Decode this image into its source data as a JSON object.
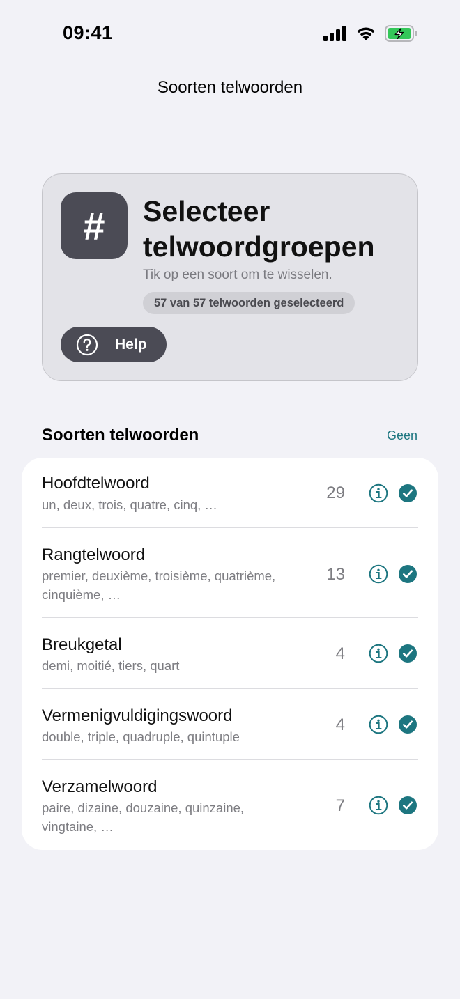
{
  "status_bar": {
    "time": "09:41",
    "icons": [
      "cellular-signal-icon",
      "wifi-icon",
      "battery-charging-icon"
    ],
    "battery_color": "#34c759"
  },
  "nav": {
    "title": "Soorten telwoorden"
  },
  "header": {
    "icon": "hash-icon",
    "icon_glyph": "#",
    "title": "Selecteer telwoordgroepen",
    "subtitle": "Tik op een soort om te wisselen.",
    "count_badge": "57 van 57 telwoorden geselecteerd",
    "help_label": "Help"
  },
  "section": {
    "title": "Soorten telwoorden",
    "action_label": "Geen"
  },
  "colors": {
    "accent": "#1d7680",
    "dark_tile": "#4b4b55",
    "background": "#f2f2f7"
  },
  "categories": [
    {
      "title": "Hoofdtelwoord",
      "examples": "un, deux, trois, quatre, cinq, …",
      "count": "29",
      "selected": true
    },
    {
      "title": "Rangtelwoord",
      "examples": "premier, deuxième, troisième, quatrième, cinquième, …",
      "count": "13",
      "selected": true
    },
    {
      "title": "Breukgetal",
      "examples": "demi, moitié, tiers, quart",
      "count": "4",
      "selected": true
    },
    {
      "title": "Vermenigvuldigingswoord",
      "examples": "double, triple, quadruple, quintuple",
      "count": "4",
      "selected": true
    },
    {
      "title": "Verzamelwoord",
      "examples": "paire, dizaine, douzaine, quinzaine, vingtaine, …",
      "count": "7",
      "selected": true
    }
  ]
}
